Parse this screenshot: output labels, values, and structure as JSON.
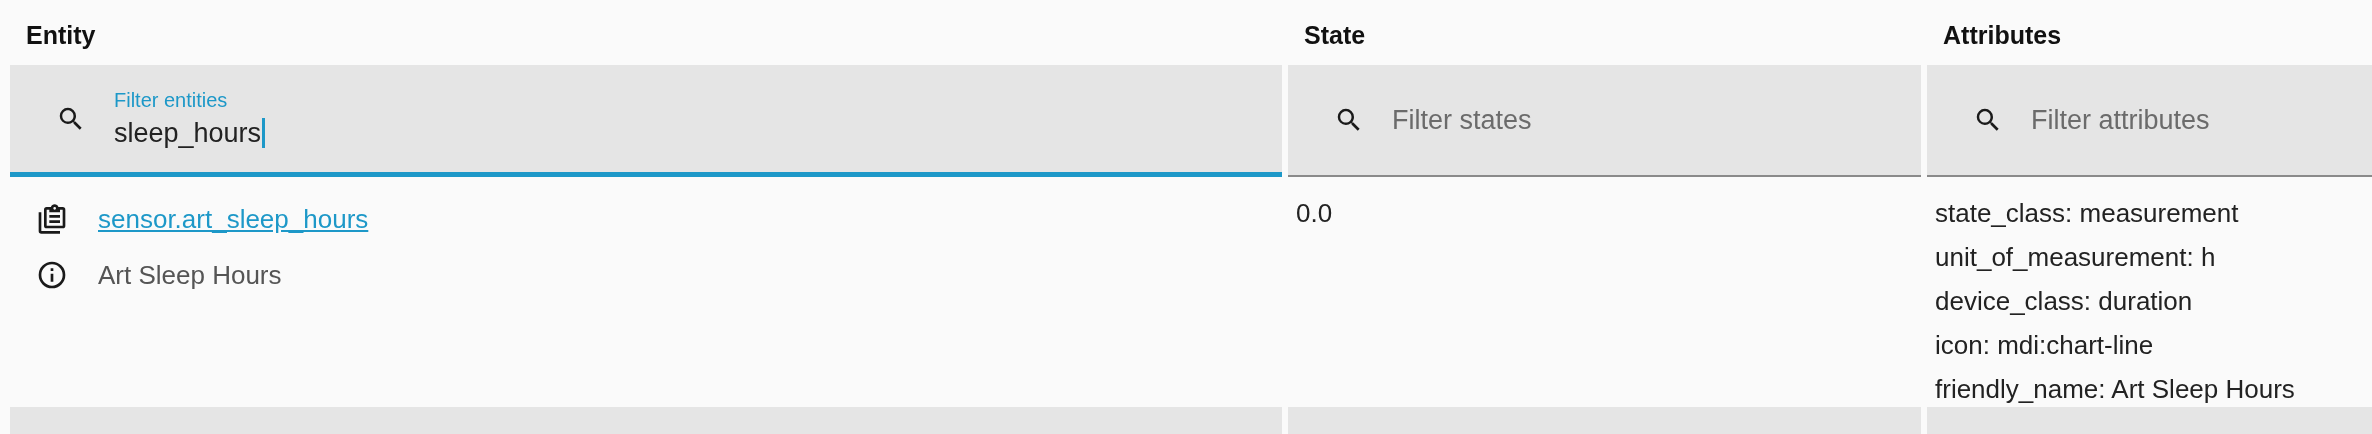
{
  "columns": [
    {
      "title": "Entity"
    },
    {
      "title": "State"
    },
    {
      "title": "Attributes"
    }
  ],
  "filters": [
    {
      "label": "Filter entities",
      "value": "sleep_hours",
      "focused": true
    },
    {
      "placeholder": "Filter states",
      "focused": false
    },
    {
      "placeholder": "Filter attributes",
      "focused": false
    }
  ],
  "rows": [
    {
      "entity_id": "sensor.art_sleep_hours",
      "friendly_name": "Art Sleep Hours",
      "state": "0.0",
      "attributes": [
        "state_class: measurement",
        "unit_of_measurement: h",
        "device_class: duration",
        "icon: mdi:chart-line",
        "friendly_name: Art Sleep Hours"
      ]
    }
  ]
}
